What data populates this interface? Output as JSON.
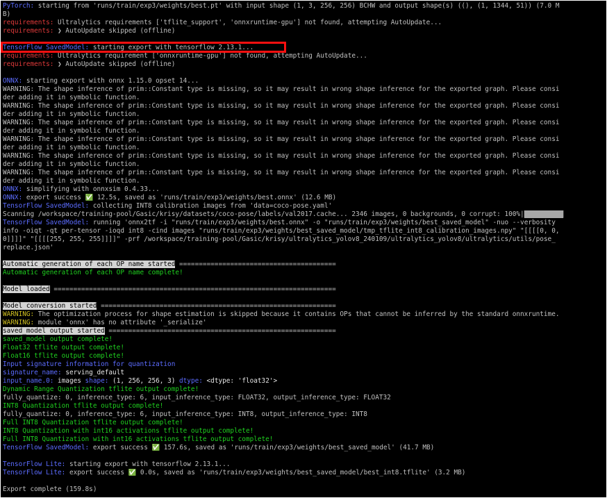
{
  "colors": {
    "background": "#000000",
    "text": "#c0c0c0",
    "blue": "#5c6cff",
    "red": "#e03a3a",
    "yellow": "#d0c020",
    "green": "#1fd01f",
    "highlight": "#ff1010"
  },
  "lines": [
    [
      {
        "t": "PyTorch:",
        "c": "blue"
      },
      {
        "t": " starting from 'runs/train/exp3/weights/best.pt' with input shape (1, 3, 256, 256) BCHW and output shape(s) ((), (1, 1344, 51)) (7.0 M"
      }
    ],
    [
      {
        "t": "B)"
      }
    ],
    [
      {
        "t": "requirements:",
        "c": "red"
      },
      {
        "t": " Ultralytics requirements ['tflite_support', 'onnxruntime-gpu'] not found, attempting AutoUpdate..."
      }
    ],
    [
      {
        "t": "requirements:",
        "c": "red"
      },
      {
        "t": " ❯ AutoUpdate skipped (offline)"
      }
    ],
    [
      {
        "t": ""
      }
    ],
    [
      {
        "t": "TensorFlow SavedModel:",
        "c": "blue"
      },
      {
        "t": " starting export with tensorflow 2.13.1..."
      }
    ],
    [
      {
        "t": "requirements:",
        "c": "red"
      },
      {
        "t": " Ultralytics requirement ['onnxruntime-gpu'] not found, attempting AutoUpdate..."
      }
    ],
    [
      {
        "t": "requirements:",
        "c": "red"
      },
      {
        "t": " ❯ AutoUpdate skipped (offline)"
      }
    ],
    [
      {
        "t": ""
      }
    ],
    [
      {
        "t": "ONNX:",
        "c": "blue"
      },
      {
        "t": " starting export with onnx 1.15.0 opset 14..."
      }
    ],
    [
      {
        "t": "WARNING: The shape inference of prim::Constant type is missing, so it may result in wrong shape inference for the exported graph. Please consi"
      }
    ],
    [
      {
        "t": "der adding it in symbolic function."
      }
    ],
    [
      {
        "t": "WARNING: The shape inference of prim::Constant type is missing, so it may result in wrong shape inference for the exported graph. Please consi"
      }
    ],
    [
      {
        "t": "der adding it in symbolic function."
      }
    ],
    [
      {
        "t": "WARNING: The shape inference of prim::Constant type is missing, so it may result in wrong shape inference for the exported graph. Please consi"
      }
    ],
    [
      {
        "t": "der adding it in symbolic function."
      }
    ],
    [
      {
        "t": "WARNING: The shape inference of prim::Constant type is missing, so it may result in wrong shape inference for the exported graph. Please consi"
      }
    ],
    [
      {
        "t": "der adding it in symbolic function."
      }
    ],
    [
      {
        "t": "WARNING: The shape inference of prim::Constant type is missing, so it may result in wrong shape inference for the exported graph. Please consi"
      }
    ],
    [
      {
        "t": "der adding it in symbolic function."
      }
    ],
    [
      {
        "t": "WARNING: The shape inference of prim::Constant type is missing, so it may result in wrong shape inference for the exported graph. Please consi"
      }
    ],
    [
      {
        "t": "der adding it in symbolic function."
      }
    ],
    [
      {
        "t": "ONNX:",
        "c": "blue"
      },
      {
        "t": " simplifying with onnxsim 0.4.33..."
      }
    ],
    [
      {
        "t": "ONNX:",
        "c": "blue"
      },
      {
        "t": " export success ✅ 12.5s, saved as 'runs/train/exp3/weights/best.onnx' (12.6 MB)"
      }
    ],
    [
      {
        "t": "TensorFlow SavedModel:",
        "c": "blue"
      },
      {
        "t": " collecting INT8 calibration images from 'data=coco-pose.yaml'"
      }
    ],
    [
      {
        "t": "Scanning /workspace/training-pool/Gasic/krisy/datasets/coco-pose/labels/val2017.cache... 2346 images, 0 backgrounds, 0 corrupt: 100%|"
      },
      {
        "t": "██████████",
        "c": "gray"
      }
    ],
    [
      {
        "t": "TensorFlow SavedModel:",
        "c": "blue"
      },
      {
        "t": " running 'onnx2tf -i \"runs/train/exp3/weights/best.onnx\" -o \"runs/train/exp3/weights/best_saved_model\" -nuo --verbosity"
      }
    ],
    [
      {
        "t": "info -oiqt -qt per-tensor -ioqd int8 -cind images \"runs/train/exp3/weights/best_saved_model/tmp_tflite_int8_calibration_images.npy\" \"[[[[0, 0,"
      }
    ],
    [
      {
        "t": "0]]]]\" \"[[[[255, 255, 255]]]]\" -prf /workspace/training-pool/Gasic/krisy/ultralytics_yolov8_240109/ultralytics_yolov8/ultralytics/utils/pose_"
      }
    ],
    [
      {
        "t": "replace.json'"
      }
    ],
    [
      {
        "t": ""
      }
    ],
    [
      {
        "t": "Automatic generation of each OP name started",
        "c": "inv"
      },
      {
        "t": " ========================================"
      }
    ],
    [
      {
        "t": "Automatic generation of each OP name complete!",
        "c": "green"
      }
    ],
    [
      {
        "t": ""
      }
    ],
    [
      {
        "t": "Model loaded",
        "c": "inv"
      },
      {
        "t": " ========================================================================"
      }
    ],
    [
      {
        "t": ""
      }
    ],
    [
      {
        "t": "Model conversion started",
        "c": "inv"
      },
      {
        "t": " ============================================================"
      }
    ],
    [
      {
        "t": "WARNING:",
        "c": "yellow"
      },
      {
        "t": " The optimization process for shape estimation is skipped because it contains OPs that cannot be inferred by the standard onnxruntime."
      }
    ],
    [
      {
        "t": "WARNING:",
        "c": "yellow"
      },
      {
        "t": " module 'onnx' has no attribute '_serialize'"
      }
    ],
    [
      {
        "t": "saved_model output started",
        "c": "inv"
      },
      {
        "t": " =========================================================="
      }
    ],
    [
      {
        "t": "saved_model output complete!",
        "c": "green"
      }
    ],
    [
      {
        "t": "Float32 tflite output complete!",
        "c": "green"
      }
    ],
    [
      {
        "t": "Float16 tflite output complete!",
        "c": "green"
      }
    ],
    [
      {
        "t": "Input signature information for quantization",
        "c": "blue"
      }
    ],
    [
      {
        "t": "signature_name:",
        "c": "blue"
      },
      {
        "t": " serving_default",
        "c": "white"
      }
    ],
    [
      {
        "t": "input_name.0:",
        "c": "blue"
      },
      {
        "t": " images ",
        "c": "white"
      },
      {
        "t": "shape:",
        "c": "blue"
      },
      {
        "t": " (1, 256, 256, 3) ",
        "c": "white"
      },
      {
        "t": "dtype:",
        "c": "blue"
      },
      {
        "t": " <dtype: 'float32'>",
        "c": "white"
      }
    ],
    [
      {
        "t": "Dynamic Range Quantization tflite output complete!",
        "c": "green"
      }
    ],
    [
      {
        "t": "fully_quantize: 0, inference_type: 6, input_inference_type: FLOAT32, output_inference_type: FLOAT32"
      }
    ],
    [
      {
        "t": "INT8 Quantization tflite output complete!",
        "c": "green"
      }
    ],
    [
      {
        "t": "fully_quantize: 0, inference_type: 6, input_inference_type: INT8, output_inference_type: INT8"
      }
    ],
    [
      {
        "t": "Full INT8 Quantization tflite output complete!",
        "c": "green"
      }
    ],
    [
      {
        "t": "INT8 Quantization with int16 activations tflite output complete!",
        "c": "green"
      }
    ],
    [
      {
        "t": "Full INT8 Quantization with int16 activations tflite output complete!",
        "c": "green"
      }
    ],
    [
      {
        "t": "TensorFlow SavedModel:",
        "c": "blue"
      },
      {
        "t": " export success ✅ 157.6s, saved as 'runs/train/exp3/weights/best_saved_model' (41.7 MB)"
      }
    ],
    [
      {
        "t": ""
      }
    ],
    [
      {
        "t": "TensorFlow Lite:",
        "c": "blue"
      },
      {
        "t": " starting export with tensorflow 2.13.1..."
      }
    ],
    [
      {
        "t": "TensorFlow Lite:",
        "c": "blue"
      },
      {
        "t": " export success ✅ 0.0s, saved as 'runs/train/exp3/weights/best_saved_model/best_int8.tflite' (3.2 MB)"
      }
    ],
    [
      {
        "t": ""
      }
    ],
    [
      {
        "t": "Export complete (159.8s)"
      }
    ]
  ]
}
